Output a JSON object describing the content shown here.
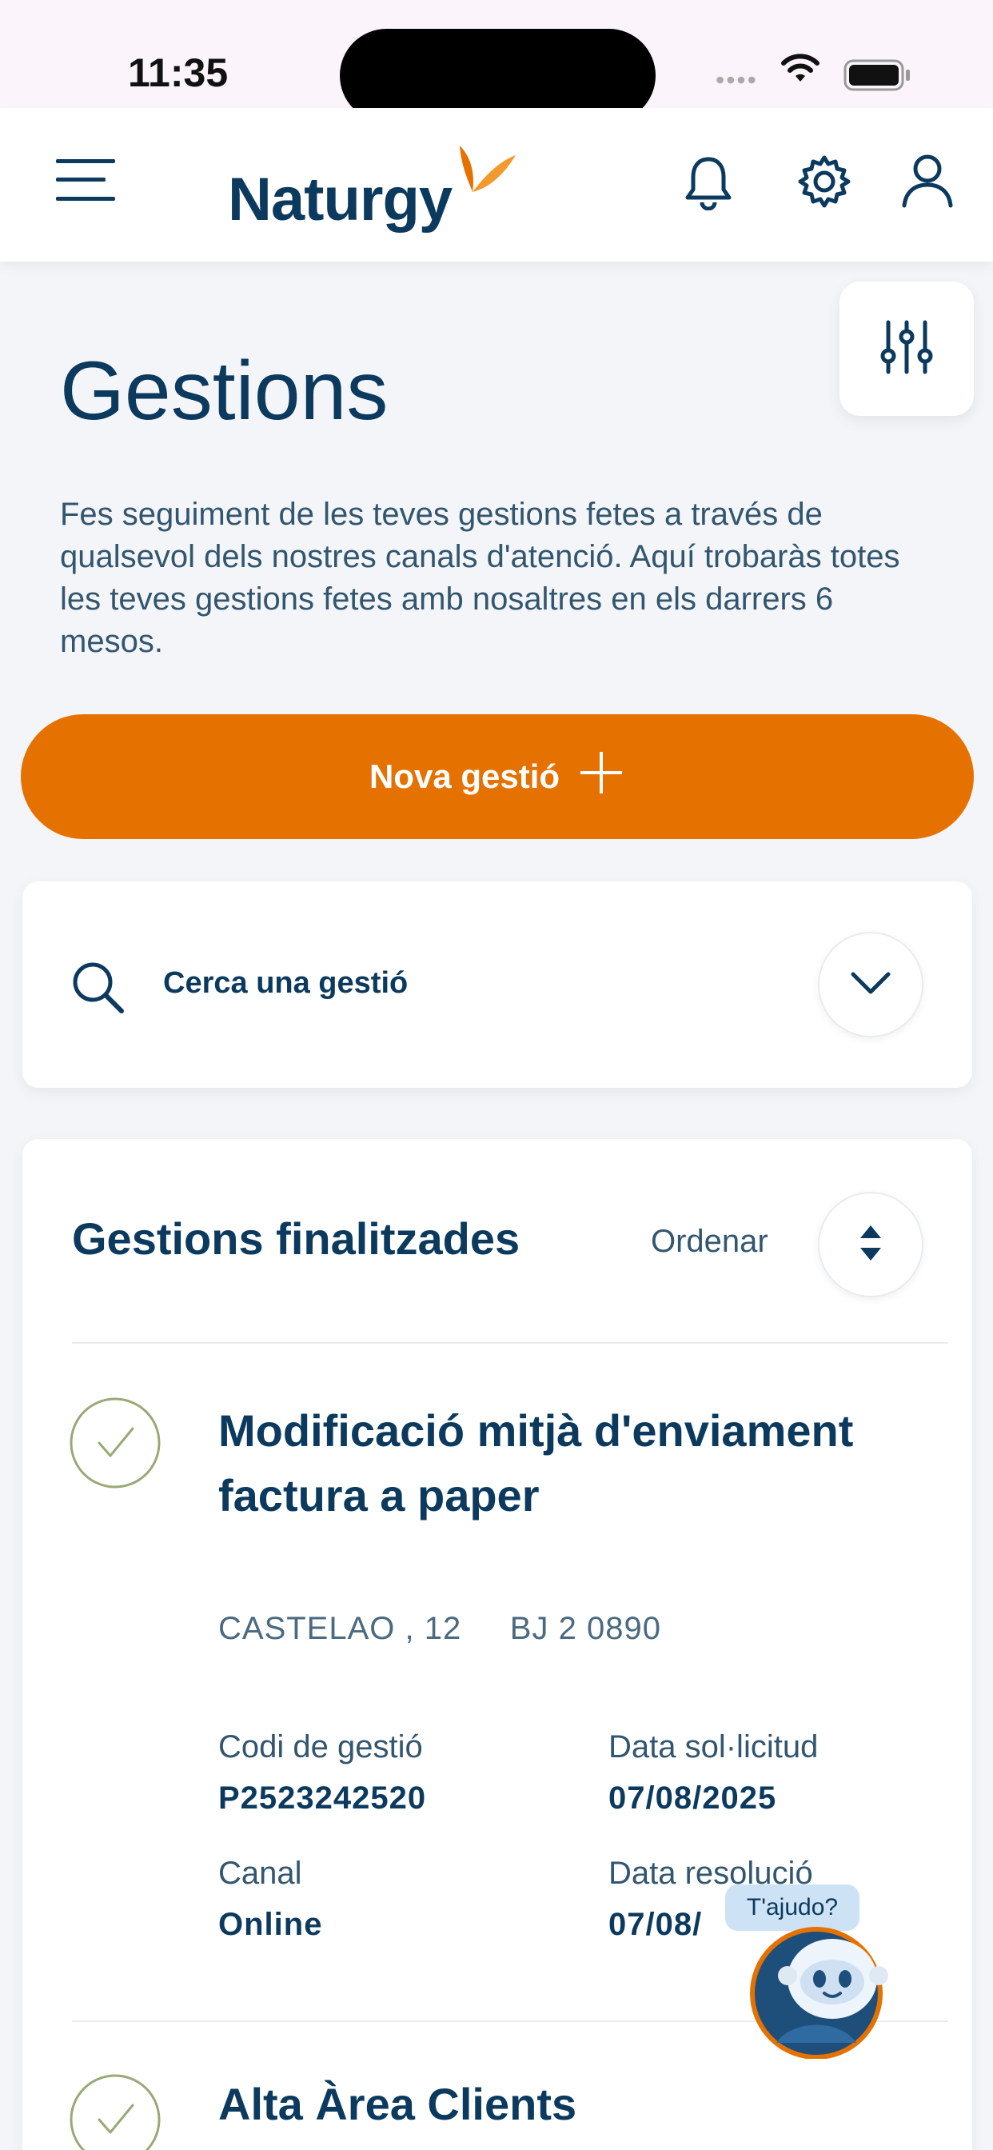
{
  "status_bar": {
    "time": "11:35"
  },
  "header": {
    "brand": "Naturgy"
  },
  "page": {
    "title": "Gestions",
    "description": "Fes seguiment de les teves gestions fetes a través de qualsevol dels nostres canals d'atenció. Aquí trobaràs totes les teves gestions fetes amb nosaltres en els darrers 6 mesos.",
    "new_button_label": "Nova gestió"
  },
  "search": {
    "label": "Cerca una gestió"
  },
  "list": {
    "title": "Gestions finalitzades",
    "sort_label": "Ordenar",
    "items": [
      {
        "title": "Modificació mitjà d'enviament factura a paper",
        "address": "CASTELAO , 12     BJ 2 0890",
        "code_label": "Codi de gestió",
        "code": "P2523242520",
        "request_date_label": "Data sol·licitud",
        "request_date": "07/08/2025",
        "channel_label": "Canal",
        "channel": "Online",
        "resolution_date_label": "Data resolució",
        "resolution_date": "07/08/"
      },
      {
        "title": "Alta Àrea Clients"
      }
    ]
  },
  "chatbot": {
    "bubble": "T'ajudo?"
  },
  "colors": {
    "primary": "#0b3a5e",
    "accent": "#e57200",
    "background": "#f3f5f8"
  },
  "icons": [
    "menu-icon",
    "logo-mark-icon",
    "bell-icon",
    "gear-icon",
    "user-icon",
    "sliders-icon",
    "plus-icon",
    "search-icon",
    "chevron-down-icon",
    "sort-icon",
    "check-circle-icon",
    "chatbot-avatar-icon"
  ]
}
